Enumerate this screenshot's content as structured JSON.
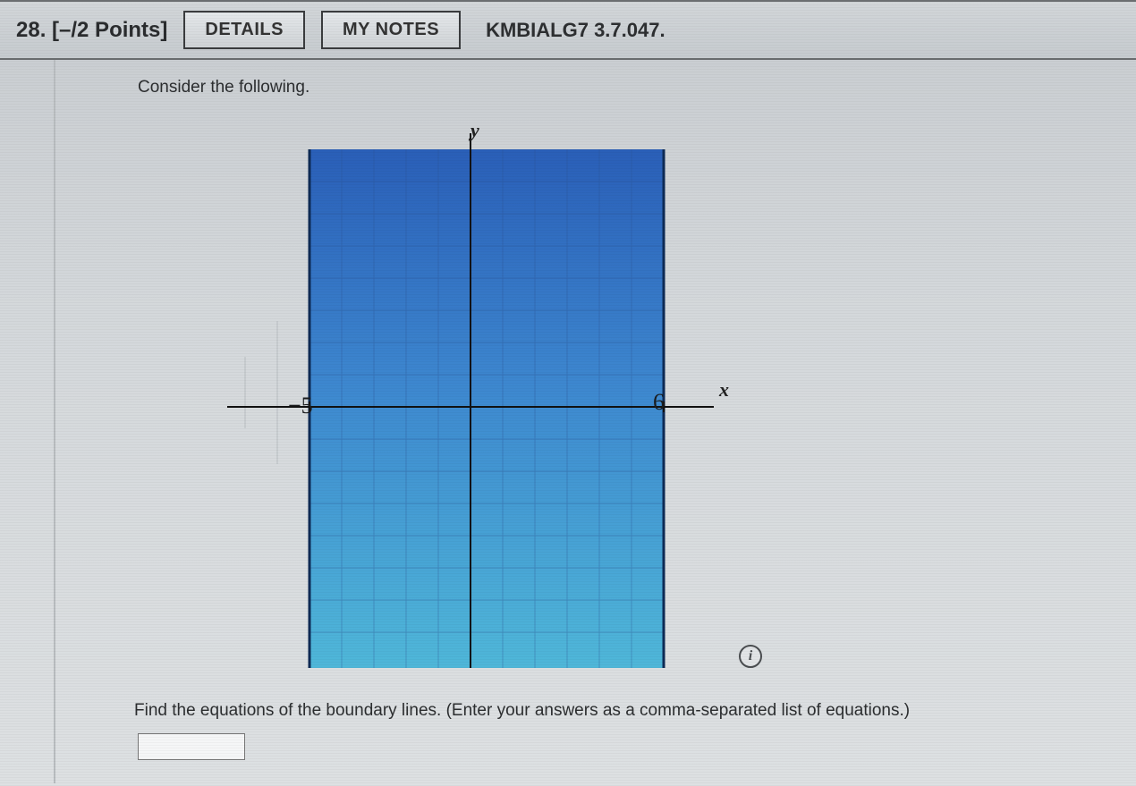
{
  "header": {
    "question_label": "28.  [–/2 Points]",
    "details_btn": "DETAILS",
    "mynotes_btn": "MY NOTES",
    "reference": "KMBIALG7 3.7.047."
  },
  "body": {
    "intro": "Consider the following.",
    "prompt": "Find the equations of the boundary lines. (Enter your answers as a comma-separated list of equations.)",
    "answer_value": ""
  },
  "chart_data": {
    "type": "area",
    "title": "",
    "xlabel": "x",
    "ylabel": "y",
    "xlim": [
      -7,
      8
    ],
    "ylim": [
      -8,
      8
    ],
    "x_ticks": [
      -5,
      6
    ],
    "shaded_region": {
      "x_min": -5,
      "x_max": 6,
      "y_min": -8,
      "y_max": 8
    },
    "boundary_lines": [
      "x = -5",
      "x = 6"
    ]
  },
  "icons": {
    "info": "i"
  }
}
